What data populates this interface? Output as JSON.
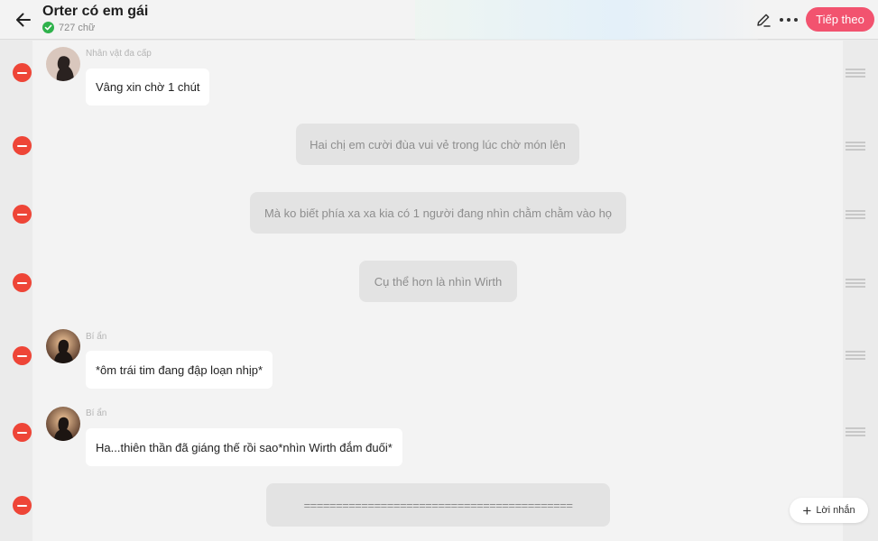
{
  "header": {
    "title": "Orter có em gái",
    "word_count": "727 chữ",
    "next_label": "Tiếp theo",
    "accent_color": "#f2536f",
    "icons": [
      "back-arrow-icon",
      "check-circle-icon",
      "edit-pencil-icon",
      "more-dots-icon"
    ]
  },
  "messages": [
    {
      "type": "character",
      "speaker": "Nhân vật đa cấp",
      "text": "Vâng xin chờ 1 chút"
    },
    {
      "type": "narration",
      "text": "Hai chị em cười đùa vui vẻ trong lúc chờ món lên"
    },
    {
      "type": "narration",
      "text": "Mà ko biết phía xa xa kia có 1 người đang nhìn chằm chằm vào họ"
    },
    {
      "type": "narration",
      "text": "Cụ thể hơn là nhìn Wirth"
    },
    {
      "type": "character",
      "speaker": "Bí ẩn",
      "text": "*ôm trái tim đang đập loạn nhịp*"
    },
    {
      "type": "character",
      "speaker": "Bí ẩn",
      "text": "Ha...thiên thần đã giáng thế rồi sao*nhìn Wirth đắm đuối*"
    },
    {
      "type": "narration",
      "text": "=========================================="
    }
  ],
  "footer": {
    "add_message_label": "Lời nhắn"
  },
  "colors": {
    "delete": "#ee4537",
    "narration_bg": "#e3e3e3",
    "bubble_bg": "#ffffff",
    "check": "#2fb24c"
  }
}
